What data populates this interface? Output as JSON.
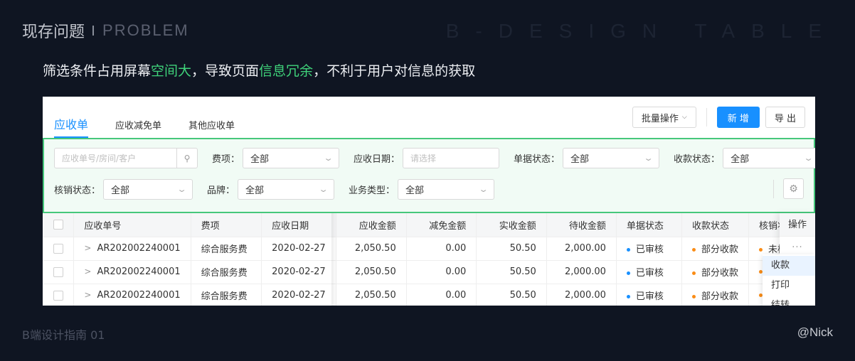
{
  "slide": {
    "title_cn": "现存问题",
    "title_en": "PROBLEM",
    "watermark": "B-DESIGN TABLE",
    "subtitle_parts": [
      "筛选条件占用屏幕",
      "空间大",
      "，导致页面",
      "信息冗余",
      "，不利于用户对信息的获取"
    ],
    "footer_left": "B端设计指南 01",
    "footer_right": "@Nick"
  },
  "tabs": [
    "应收单",
    "应收减免单",
    "其他应收单"
  ],
  "actions": {
    "batch": "批量操作",
    "new": "新 增",
    "export": "导 出"
  },
  "filters": {
    "search_placeholder": "应收单号/房间/客户",
    "fee_label": "费项：",
    "fee_value": "全部",
    "date_label": "应收日期：",
    "date_placeholder": "请选择",
    "doc_status_label": "单据状态：",
    "doc_status_value": "全部",
    "pay_status_label": "收款状态：",
    "pay_status_value": "全部",
    "writeoff_label": "核销状态：",
    "writeoff_value": "全部",
    "brand_label": "品牌：",
    "brand_value": "全部",
    "biz_type_label": "业务类型：",
    "biz_type_value": "全部"
  },
  "table": {
    "headers": [
      "应收单号",
      "费项",
      "应收日期",
      "应收金额",
      "减免金额",
      "实收金额",
      "待收金额",
      "单据状态",
      "收款状态",
      "核销状"
    ],
    "op_header": "操作",
    "rows": [
      [
        "AR202002240001",
        "综合服务费",
        "2020-02-27",
        "2,050.50",
        "0.00",
        "50.50",
        "2,000.00",
        "已审核",
        "部分收款",
        "未核"
      ],
      [
        "AR202002240001",
        "综合服务费",
        "2020-02-27",
        "2,050.50",
        "0.00",
        "50.50",
        "2,000.00",
        "已审核",
        "部分收款",
        ""
      ],
      [
        "AR202002240001",
        "综合服务费",
        "2020-02-27",
        "2,050.50",
        "0.00",
        "50.50",
        "2,000.00",
        "已审核",
        "部分收款",
        ""
      ]
    ],
    "more": "···"
  },
  "dropdown": [
    "收款",
    "打印",
    "结转"
  ],
  "colors": {
    "accent": "#1890ff",
    "highlight": "#3fd27a",
    "status_blue": "#1890ff",
    "status_orange": "#fa8c16"
  }
}
